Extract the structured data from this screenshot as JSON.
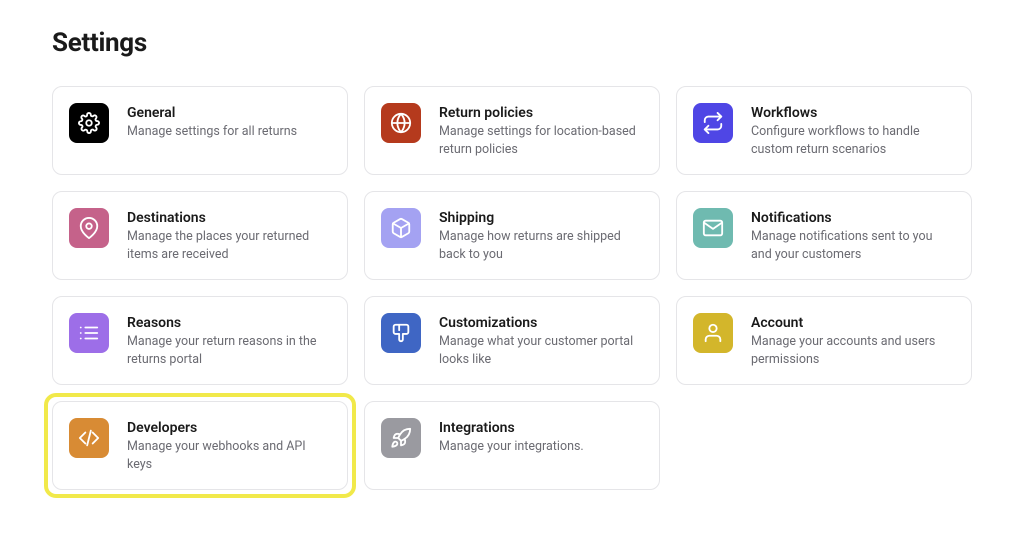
{
  "page_title": "Settings",
  "cards": [
    {
      "id": "general",
      "title": "General",
      "desc": "Manage settings for all returns",
      "icon_bg": "#000000",
      "icon_fg": "#ffffff"
    },
    {
      "id": "return-policies",
      "title": "Return policies",
      "desc": "Manage settings for location-based return policies",
      "icon_bg": "#b53a1d",
      "icon_fg": "#ffffff"
    },
    {
      "id": "workflows",
      "title": "Workflows",
      "desc": "Configure workflows to handle custom return scenarios",
      "icon_bg": "#4f46e5",
      "icon_fg": "#ffffff"
    },
    {
      "id": "destinations",
      "title": "Destinations",
      "desc": "Manage the places your returned items are received",
      "icon_bg": "#c5628a",
      "icon_fg": "#ffffff"
    },
    {
      "id": "shipping",
      "title": "Shipping",
      "desc": "Manage how returns are shipped back to you",
      "icon_bg": "#a4a2f2",
      "icon_fg": "#ffffff"
    },
    {
      "id": "notifications",
      "title": "Notifications",
      "desc": "Manage notifications sent to you and your customers",
      "icon_bg": "#6fbab0",
      "icon_fg": "#ffffff"
    },
    {
      "id": "reasons",
      "title": "Reasons",
      "desc": "Manage your return reasons in the returns portal",
      "icon_bg": "#9d6ee8",
      "icon_fg": "#ffffff"
    },
    {
      "id": "customizations",
      "title": "Customizations",
      "desc": "Manage what your customer portal looks like",
      "icon_bg": "#3f66c4",
      "icon_fg": "#ffffff"
    },
    {
      "id": "account",
      "title": "Account",
      "desc": "Manage your accounts and users permissions",
      "icon_bg": "#d3b62b",
      "icon_fg": "#ffffff"
    },
    {
      "id": "developers",
      "title": "Developers",
      "desc": "Manage your webhooks and API keys",
      "icon_bg": "#d88b34",
      "icon_fg": "#ffffff",
      "highlighted": true
    },
    {
      "id": "integrations",
      "title": "Integrations",
      "desc": "Manage your integrations.",
      "icon_bg": "#9a9aa0",
      "icon_fg": "#ffffff"
    }
  ]
}
